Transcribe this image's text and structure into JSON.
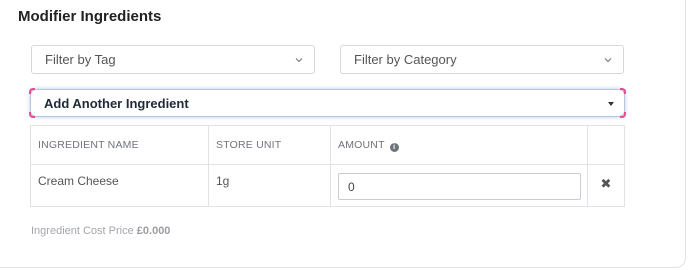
{
  "section": {
    "title": "Modifier Ingredients"
  },
  "filters": {
    "tag": {
      "selected": "Filter by Tag"
    },
    "category": {
      "selected": "Filter by Category"
    }
  },
  "add_ingredient": {
    "label": "Add Another Ingredient"
  },
  "table": {
    "headers": [
      "INGREDIENT NAME",
      "STORE UNIT",
      "AMOUNT"
    ],
    "rows": [
      {
        "name": "Cream Cheese",
        "unit": "1g",
        "amount": "0"
      }
    ]
  },
  "cost": {
    "label": "Ingredient Cost Price",
    "value": "£0.000"
  },
  "icons": {
    "filter_chevron": "chevron-down-icon",
    "add_caret": "caret-down-icon",
    "amount_info": "info-icon",
    "remove": "close-icon"
  }
}
